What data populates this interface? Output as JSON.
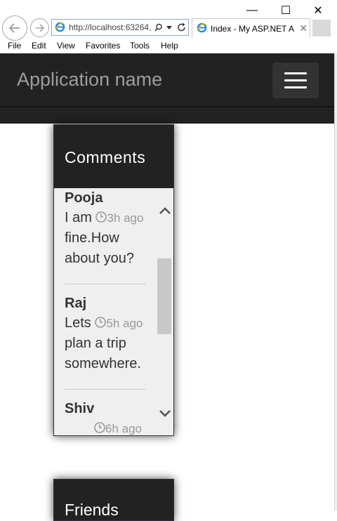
{
  "browser": {
    "address_url": "http://localhost:63264,",
    "tab_title": "Index - My ASP.NET A...",
    "menu": [
      "File",
      "Edit",
      "View",
      "Favorites",
      "Tools",
      "Help"
    ],
    "window_controls": {
      "minimize": "—",
      "maximize": "☐",
      "close": "✕"
    },
    "tab_close": "✕"
  },
  "app": {
    "brand": "Application name"
  },
  "comments_panel": {
    "title": "Comments",
    "comments": [
      {
        "name": "Pooja",
        "lines": [
          "I am",
          "fine.How",
          "about you?"
        ],
        "time": "3h ago"
      },
      {
        "name": "Raj",
        "lines": [
          "Lets",
          "plan a trip",
          "somewhere."
        ],
        "time": "5h ago"
      },
      {
        "name": "Shiv",
        "lines": [
          ""
        ],
        "time": "6h ago"
      }
    ]
  },
  "friends_panel": {
    "title": "Friends"
  },
  "colors": {
    "navbar": "#222222",
    "brand_text": "#9d9d9d",
    "panel_bg": "#efefef",
    "time_text": "#999999"
  }
}
